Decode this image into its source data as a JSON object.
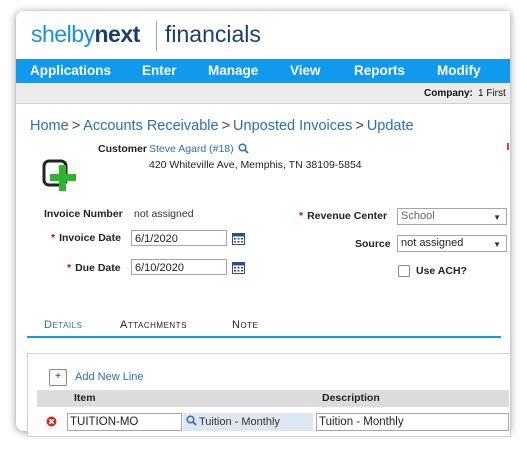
{
  "brand": {
    "logo_light": "shelby",
    "logo_bold": "next",
    "product": "financials"
  },
  "nav": [
    "Applications",
    "Enter",
    "Manage",
    "View",
    "Reports",
    "Modify"
  ],
  "company": {
    "label": "Company:",
    "value": "1 First"
  },
  "breadcrumb": [
    "Home",
    "Accounts Receivable",
    "Unposted Invoices",
    "Update"
  ],
  "breadcrumb_sep": ">",
  "customer": {
    "label": "Customer",
    "name": "Steve Agard (#18)",
    "address": "420 Whiteville Ave, Memphis, TN 38109-5854"
  },
  "form": {
    "invoice_number_label": "Invoice Number",
    "invoice_number_value": "not assigned",
    "invoice_date_label": "Invoice Date",
    "invoice_date_value": "6/1/2020",
    "due_date_label": "Due Date",
    "due_date_value": "6/10/2020",
    "revenue_center_label": "Revenue Center",
    "revenue_center_value": "School",
    "source_label": "Source",
    "source_value": "not assigned",
    "use_ach_label": "Use ACH?",
    "required_mark": "*"
  },
  "tabs": [
    "Details",
    "Attachments",
    "Note"
  ],
  "grid": {
    "add_line_label": "Add New Line",
    "columns": [
      "Item",
      "Description"
    ],
    "rows": [
      {
        "item": "TUITION-MO",
        "lookup": "Tuition - Monthly",
        "description": "Tuition - Monthly"
      }
    ]
  },
  "colors": {
    "nav_bg": "#1199ee",
    "link": "#2b6fb2",
    "required": "#d0021b",
    "add_icon": "#2db52d"
  }
}
